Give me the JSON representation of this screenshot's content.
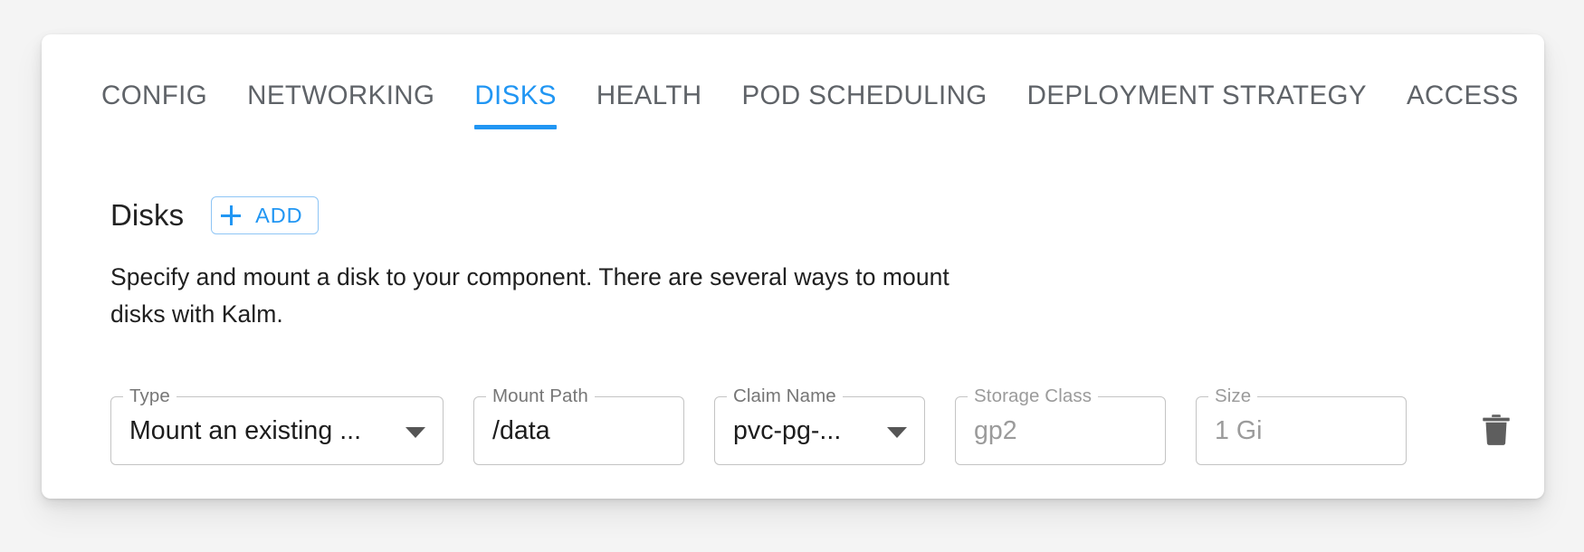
{
  "tabs": [
    {
      "label": "CONFIG",
      "active": false
    },
    {
      "label": "NETWORKING",
      "active": false
    },
    {
      "label": "DISKS",
      "active": true
    },
    {
      "label": "HEALTH",
      "active": false
    },
    {
      "label": "POD SCHEDULING",
      "active": false
    },
    {
      "label": "DEPLOYMENT STRATEGY",
      "active": false
    },
    {
      "label": "ACCESS",
      "active": false
    }
  ],
  "section": {
    "title": "Disks",
    "add_label": "ADD",
    "description": "Specify and mount a disk to your component. There are several ways to mount disks with Kalm."
  },
  "disk_row": {
    "type": {
      "label": "Type",
      "value": "Mount an existing ..."
    },
    "mount_path": {
      "label": "Mount Path",
      "value": "/data"
    },
    "claim_name": {
      "label": "Claim Name",
      "value": "pvc-pg-..."
    },
    "storage_class": {
      "label": "Storage Class",
      "placeholder": "gp2"
    },
    "size": {
      "label": "Size",
      "placeholder": "1 Gi"
    },
    "delete_icon": "trash-icon"
  },
  "colors": {
    "accent": "#2196f3",
    "page_background": "#f4f4f4",
    "card_background": "#ffffff",
    "tab_inactive_text": "#5f6368",
    "field_border": "#c4c4c4",
    "placeholder_text": "#9b9b9b"
  }
}
